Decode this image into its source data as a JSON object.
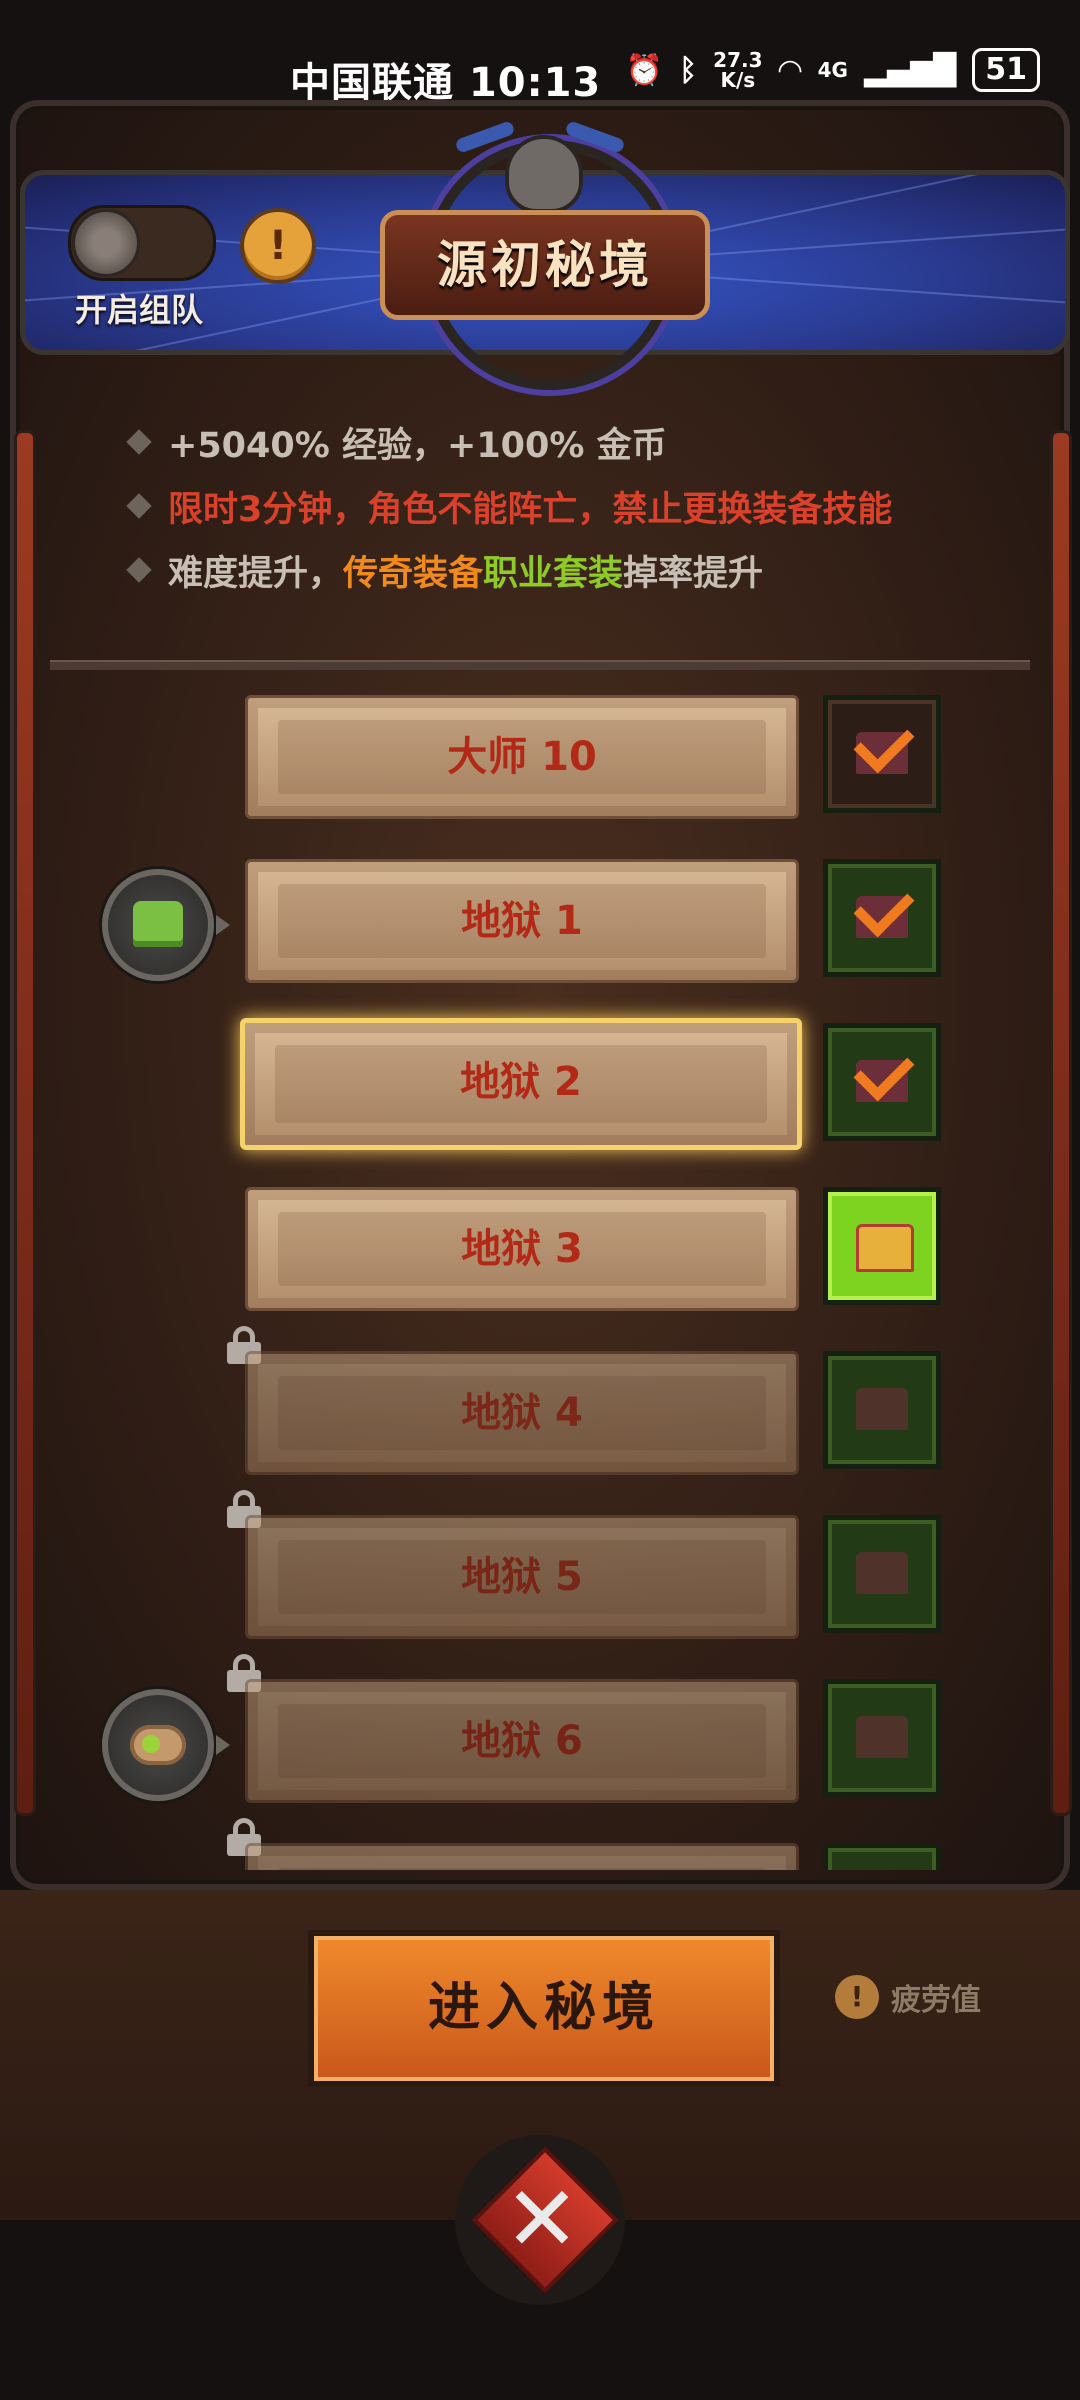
{
  "status_bar": {
    "carrier_time": "中国联通 10:13",
    "net_speed_value": "27.3",
    "net_speed_unit": "K/s",
    "network": "4G",
    "battery": "51",
    "icons": [
      "alarm-icon",
      "bluetooth-icon",
      "wifi-icon",
      "signal-icon"
    ]
  },
  "header": {
    "title": "源初秘境",
    "team_label": "开启组队",
    "team_toggle_on": false,
    "info_symbol": "!"
  },
  "bullets": [
    {
      "parts": [
        {
          "text": "+5040% 经验，+100% 金币",
          "color": "gray"
        }
      ]
    },
    {
      "parts": [
        {
          "text": "限时3分钟，角色不能阵亡，禁止更换装备技能",
          "color": "red"
        }
      ]
    },
    {
      "parts": [
        {
          "text": "难度提升，",
          "color": "gray"
        },
        {
          "text": "传奇装备",
          "color": "orange"
        },
        {
          "text": " ",
          "color": "gray"
        },
        {
          "text": "职业套装",
          "color": "green"
        },
        {
          "text": " 掉率提升",
          "color": "gray"
        }
      ]
    }
  ],
  "tiers": [
    {
      "label": "大师 10",
      "state": "completed",
      "locked": false,
      "selected": false,
      "reward": null,
      "chest": "dark"
    },
    {
      "label": "地狱 1",
      "state": "completed",
      "locked": false,
      "selected": false,
      "reward": "shirt-icon",
      "chest": "green"
    },
    {
      "label": "地狱 2",
      "state": "completed",
      "locked": false,
      "selected": true,
      "reward": null,
      "chest": "green"
    },
    {
      "label": "地狱 3",
      "state": "available",
      "locked": false,
      "selected": false,
      "reward": null,
      "chest": "bright"
    },
    {
      "label": "地狱 4",
      "state": "locked",
      "locked": true,
      "selected": false,
      "reward": null,
      "chest": "green"
    },
    {
      "label": "地狱 5",
      "state": "locked",
      "locked": true,
      "selected": false,
      "reward": null,
      "chest": "green"
    },
    {
      "label": "地狱 6",
      "state": "locked",
      "locked": true,
      "selected": false,
      "reward": "scroll-icon",
      "chest": "green"
    },
    {
      "label": "",
      "state": "locked",
      "locked": true,
      "selected": false,
      "reward": null,
      "chest": "green"
    }
  ],
  "enter_button": "进入秘境",
  "fatigue": {
    "icon_text": "!",
    "label": "疲劳值"
  },
  "colors": {
    "red": "#d9412a",
    "gray": "#c8bfb4",
    "orange": "#f08a1c",
    "green": "#8ecb27",
    "button": "#e07424",
    "header_blue": "#3457c9"
  }
}
